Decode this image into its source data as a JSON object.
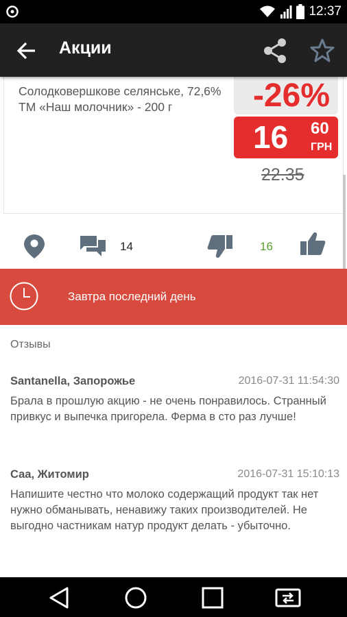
{
  "status_bar": {
    "time": "12:37"
  },
  "app_bar": {
    "title": "Акции"
  },
  "product": {
    "name": "Солодковершкове селянське, 72,6% ТМ «Наш молочник» - 200 г",
    "discount": "-26%",
    "price_main": "16",
    "price_kop": "60",
    "currency": "ГРН",
    "old_price": "22.35"
  },
  "actions": {
    "comments_count": "14",
    "likes_count": "16"
  },
  "banner": {
    "text": "Завтра последний день"
  },
  "reviews": {
    "heading": "Отзывы",
    "items": [
      {
        "author": "Santanella, Запорожье",
        "date": "2016-07-31 11:54:30",
        "text": "Брала в прошлую акцию - не очень понравилось. Странный привкус и выпечка пригорела. Ферма в сто раз лучше!"
      },
      {
        "author": "Саа, Житомир",
        "date": "2016-07-31 15:10:13",
        "text": "Напишите честно что молоко содержащий продукт так нет нужно обманывать, ненавижу таких производителей. Не выгодно частникам натур продукт делать - убыточно."
      }
    ]
  },
  "colors": {
    "accent_red": "#e52d2d",
    "banner_red": "#d84a3e",
    "app_bar": "#212121",
    "likes_green": "#5aa02c",
    "icon_gray": "#5f6f7d"
  },
  "icons": {
    "status": [
      "notification-icon",
      "wifi-icon",
      "signal-icon",
      "battery-icon"
    ],
    "app_bar": [
      "back-arrow-icon",
      "share-icon",
      "star-icon"
    ],
    "actions": [
      "location-icon",
      "comments-icon",
      "thumbs-down-icon",
      "thumbs-up-icon"
    ],
    "banner": "clock-icon",
    "nav": [
      "nav-back-icon",
      "nav-home-icon",
      "nav-recents-icon",
      "nav-screen-switch-icon"
    ]
  }
}
